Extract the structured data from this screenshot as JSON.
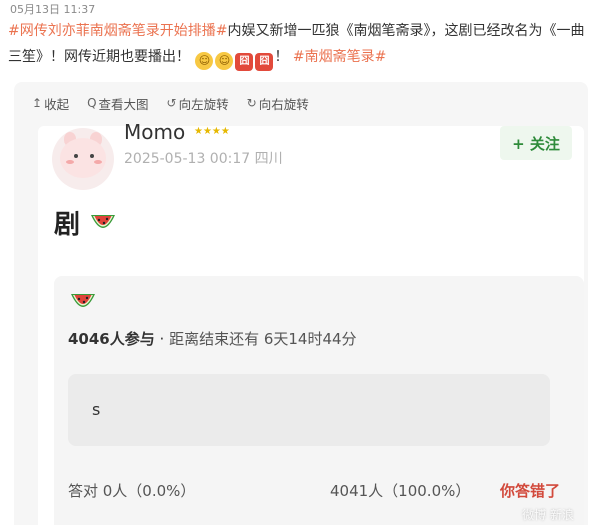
{
  "header": {
    "timestamp": "05月13日 11:37"
  },
  "post": {
    "tag_main": "#网传刘亦菲南烟斋笔录开始排播#",
    "text_1": "内娱又新增一匹狼《南烟笔斋录》，这剧已经改名为《一曲三笙》！网传近期也要播出！",
    "emoji_1": "face-emoji",
    "emoji_2": "face-emoji",
    "emoji_3": "囧",
    "emoji_4": "囧",
    "text_2": "！",
    "tag_end": "#南烟斋笔录#"
  },
  "toolbar": {
    "collapse": "收起",
    "collapse_icon": "↥",
    "view_large": "查看大图",
    "view_large_icon": "Q",
    "rotate_left": "向左旋转",
    "rotate_left_icon": "↺",
    "rotate_right": "向右旋转",
    "rotate_right_icon": "↻"
  },
  "card": {
    "username": "Momo",
    "user_badge": "★★★★",
    "meta": "2025-05-13 00:17 四川",
    "follow": "+ 关注",
    "title": "剧"
  },
  "poll": {
    "stats_count": "4046人参与",
    "stats_sep": " · ",
    "stats_deadline": "距离结束还有 6天14时44分",
    "option": "s",
    "result_left": "答对 0人（0.0%）",
    "result_right": "4041人（100.0%）",
    "result_wrong": "你答错了"
  },
  "watermark": "微博 新浪"
}
